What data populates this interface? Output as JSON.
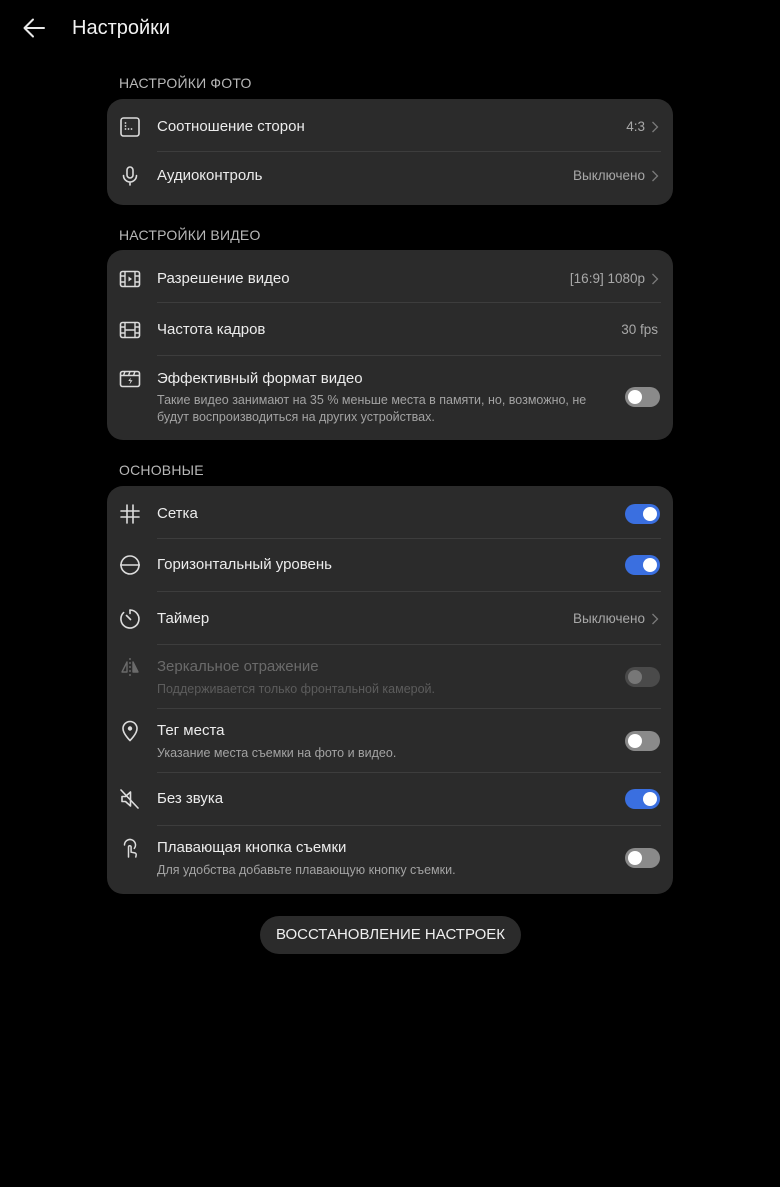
{
  "header": {
    "title": "Настройки"
  },
  "sections": {
    "photo": {
      "label": "НАСТРОЙКИ ФОТО",
      "aspect": {
        "label": "Соотношение сторон",
        "value": "4:3",
        "icon": "aspect-ratio-icon"
      },
      "audio": {
        "label": "Аудиоконтроль",
        "value": "Выключено",
        "icon": "microphone-icon"
      }
    },
    "video": {
      "label": "НАСТРОЙКИ ВИДЕО",
      "resolution": {
        "label": "Разрешение видео",
        "value": "[16:9] 1080p",
        "icon": "video-resolution-icon"
      },
      "framerate": {
        "label": "Частота кадров",
        "value": "30 fps",
        "icon": "film-icon"
      },
      "efficient": {
        "label": "Эффективный формат видео",
        "sub": "Такие видео занимают на 35 % меньше места в памяти, но, возможно, не будут воспроизводиться на других устройствах.",
        "enabled": false,
        "icon": "efficient-format-icon"
      }
    },
    "general": {
      "label": "ОСНОВНЫЕ",
      "grid": {
        "label": "Сетка",
        "enabled": true,
        "icon": "grid-icon"
      },
      "level": {
        "label": "Горизонтальный уровень",
        "enabled": true,
        "icon": "level-icon"
      },
      "timer": {
        "label": "Таймер",
        "value": "Выключено",
        "icon": "timer-icon"
      },
      "mirror": {
        "label": "Зеркальное отражение",
        "sub": "Поддерживается только фронтальной камерой.",
        "enabled": false,
        "disabled": true,
        "icon": "mirror-icon"
      },
      "location": {
        "label": "Тег места",
        "sub": "Указание места съемки на фото и видео.",
        "enabled": false,
        "icon": "location-pin-icon"
      },
      "mute": {
        "label": "Без звука",
        "enabled": true,
        "icon": "mute-icon"
      },
      "floating": {
        "label": "Плавающая кнопка съемки",
        "sub": "Для удобства добавьте плавающую кнопку съемки.",
        "enabled": false,
        "icon": "floating-shutter-icon"
      }
    }
  },
  "reset": {
    "label": "ВОССТАНОВЛЕНИЕ НАСТРОЕК"
  },
  "colors": {
    "background": "#000000",
    "card": "#2b2b2b",
    "accent": "#3a6fe0",
    "divider": "#3d3d3d"
  }
}
